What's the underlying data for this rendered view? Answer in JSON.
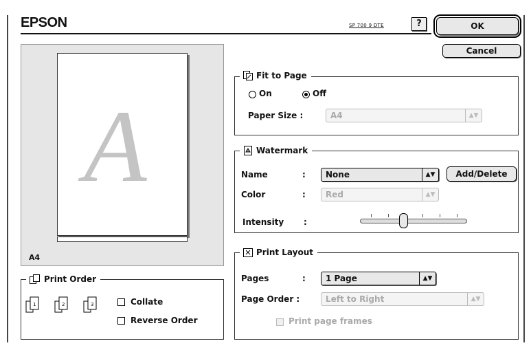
{
  "header": {
    "brand": "EPSON",
    "model": "SP 700 9 DTE",
    "help_glyph": "?",
    "ok_label": "OK",
    "cancel_label": "Cancel"
  },
  "preview": {
    "page_letter": "A",
    "paper_size": "A4"
  },
  "fit_to_page": {
    "title": "Fit to Page",
    "on_label": "On",
    "off_label": "Off",
    "selected": "Off",
    "paper_size_label": "Paper Size :",
    "paper_size_value": "A4"
  },
  "watermark": {
    "title": "Watermark",
    "name_label": "Name",
    "name_value": "None",
    "add_delete_label": "Add/Delete",
    "color_label": "Color",
    "color_value": "Red",
    "intensity_label": "Intensity",
    "colon": ":",
    "intensity_level": 0.4
  },
  "print_layout": {
    "title": "Print Layout",
    "pages_label": "Pages",
    "pages_value": "1 Page",
    "page_order_label": "Page Order :",
    "page_order_value": "Left to Right",
    "print_frames_label": "Print page frames",
    "print_frames_checked": false
  },
  "print_order": {
    "title": "Print Order",
    "collate_label": "Collate",
    "reverse_label": "Reverse Order",
    "collate_checked": false,
    "reverse_checked": false
  }
}
